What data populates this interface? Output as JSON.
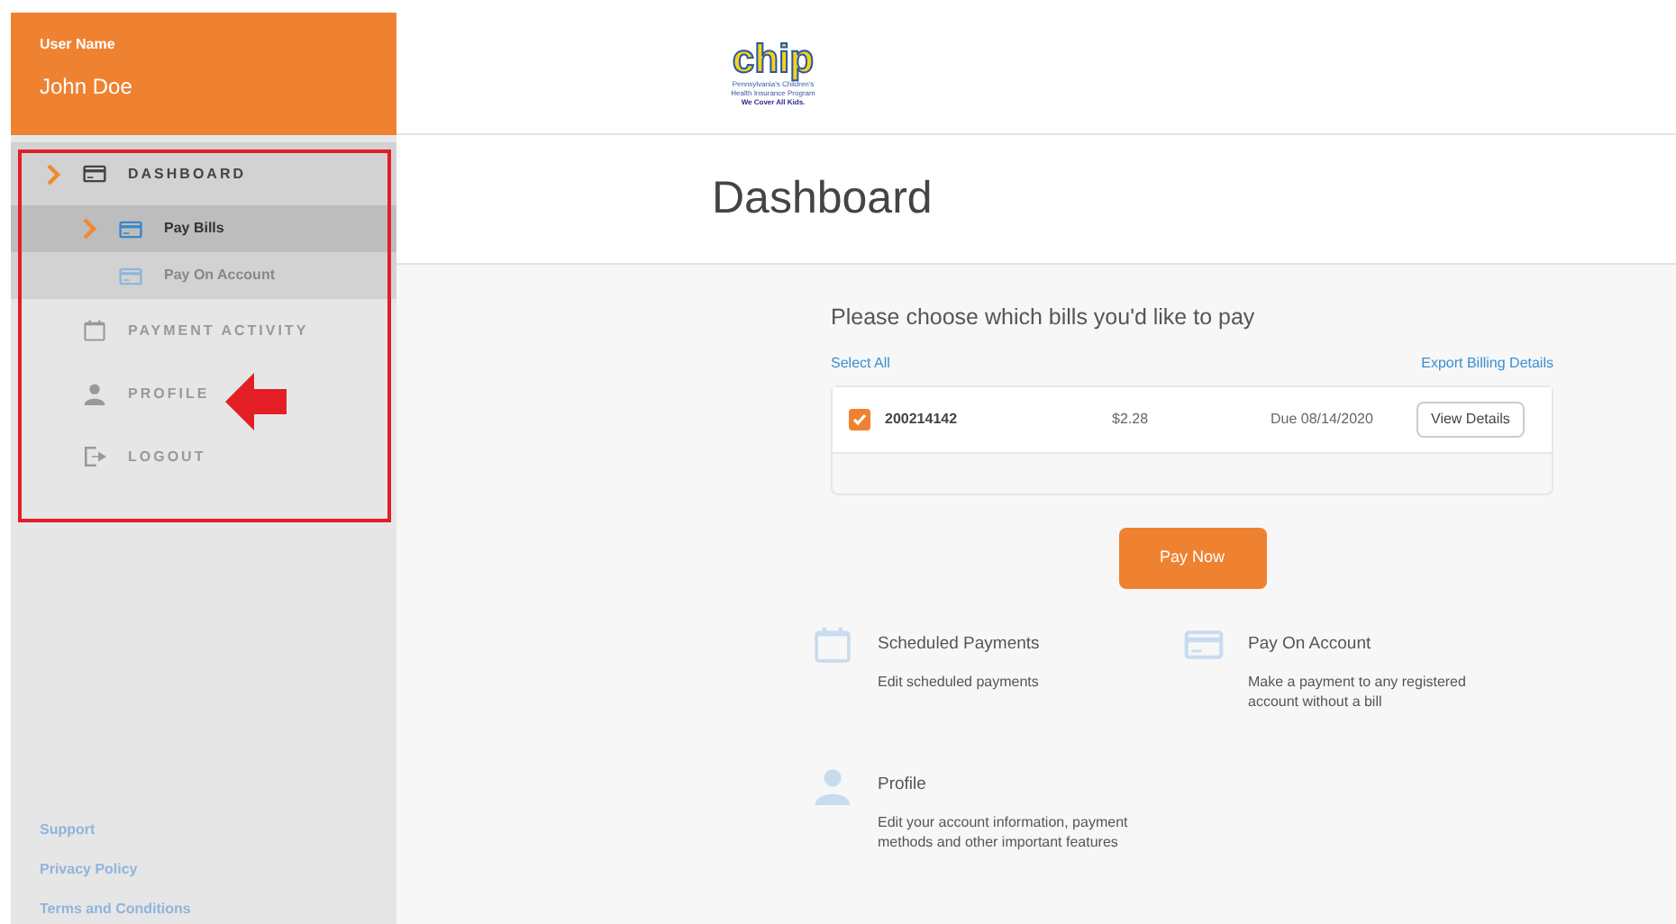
{
  "user": {
    "label": "User Name",
    "name": "John Doe"
  },
  "logo": {
    "mark": "chip",
    "lines": [
      "Pennsylvania's Children's",
      "Health Insurance Program",
      "We Cover All Kids."
    ]
  },
  "sidebar": {
    "items": [
      {
        "label": "DASHBOARD",
        "kind": "card",
        "expanded": true,
        "children": [
          {
            "label": "Pay Bills",
            "kind": "card",
            "selected": true
          },
          {
            "label": "Pay On Account",
            "kind": "card",
            "selected": false
          }
        ]
      },
      {
        "label": "PAYMENT ACTIVITY",
        "kind": "calendar",
        "expanded": false
      },
      {
        "label": "PROFILE",
        "kind": "user",
        "expanded": false
      },
      {
        "label": "LOGOUT",
        "kind": "logout",
        "expanded": false
      }
    ],
    "footer_links": [
      "Support",
      "Privacy Policy",
      "Terms and Conditions"
    ]
  },
  "page_title": "Dashboard",
  "bills": {
    "heading": "Please choose which bills you'd like to pay",
    "select_all": "Select All",
    "export": "Export Billing Details",
    "rows": [
      {
        "account": "200214142",
        "amount": "$2.28",
        "due": "Due 08/14/2020",
        "checked": true,
        "action": "View Details"
      }
    ],
    "pay_button": "Pay Now"
  },
  "tiles": [
    {
      "kind": "calendar",
      "title": "Scheduled Payments",
      "text": "Edit scheduled payments"
    },
    {
      "kind": "card",
      "title": "Pay On Account",
      "text": "Make a payment to any registered account without a bill"
    },
    {
      "kind": "user",
      "title": "Profile",
      "text": "Edit your account information, payment methods and other important features"
    }
  ]
}
